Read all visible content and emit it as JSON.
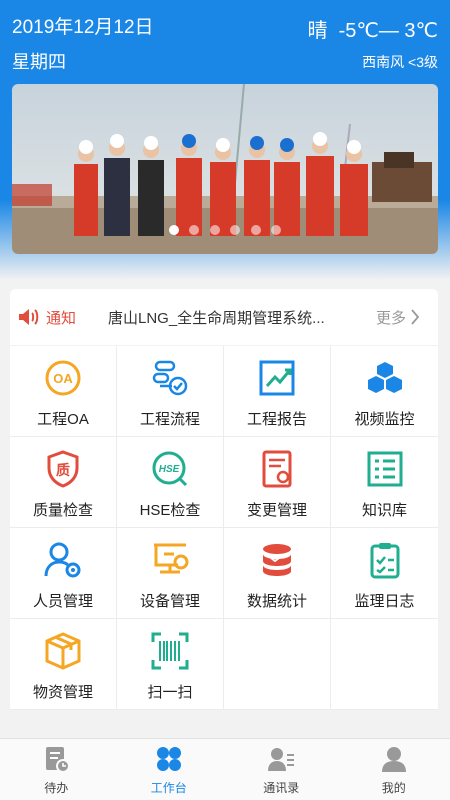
{
  "header": {
    "date": "2019年12月12日",
    "weekday": "星期四",
    "weather": "晴  -5℃— 3℃",
    "wind": "西南风 <3级"
  },
  "banner": {
    "slide_count": 6,
    "active_slide": 1
  },
  "notice": {
    "label": "通知",
    "text": "唐山LNG_全生命周期管理系统...",
    "more": "更多"
  },
  "grid": {
    "items": [
      {
        "label": "工程OA",
        "icon": "oa-icon"
      },
      {
        "label": "工程流程",
        "icon": "workflow-icon"
      },
      {
        "label": "工程报告",
        "icon": "report-chart-icon"
      },
      {
        "label": "视频监控",
        "icon": "cubes-icon"
      },
      {
        "label": "质量检查",
        "icon": "quality-shield-icon"
      },
      {
        "label": "HSE检查",
        "icon": "hse-icon"
      },
      {
        "label": "变更管理",
        "icon": "change-document-icon"
      },
      {
        "label": "知识库",
        "icon": "knowledge-list-icon"
      },
      {
        "label": "人员管理",
        "icon": "user-gear-icon"
      },
      {
        "label": "设备管理",
        "icon": "monitor-gear-icon"
      },
      {
        "label": "数据统计",
        "icon": "database-icon"
      },
      {
        "label": "监理日志",
        "icon": "clipboard-check-icon"
      },
      {
        "label": "物资管理",
        "icon": "box-icon"
      },
      {
        "label": "扫一扫",
        "icon": "barcode-scan-icon"
      }
    ]
  },
  "colors": {
    "primary": "#1a87e6",
    "orange": "#f5a623",
    "red": "#e24c3d",
    "teal": "#1fae8f"
  },
  "tabbar": {
    "tabs": [
      {
        "label": "待办",
        "icon": "todo-icon",
        "active": false
      },
      {
        "label": "工作台",
        "icon": "workbench-icon",
        "active": true
      },
      {
        "label": "通讯录",
        "icon": "contacts-icon",
        "active": false
      },
      {
        "label": "我的",
        "icon": "profile-icon",
        "active": false
      }
    ]
  }
}
